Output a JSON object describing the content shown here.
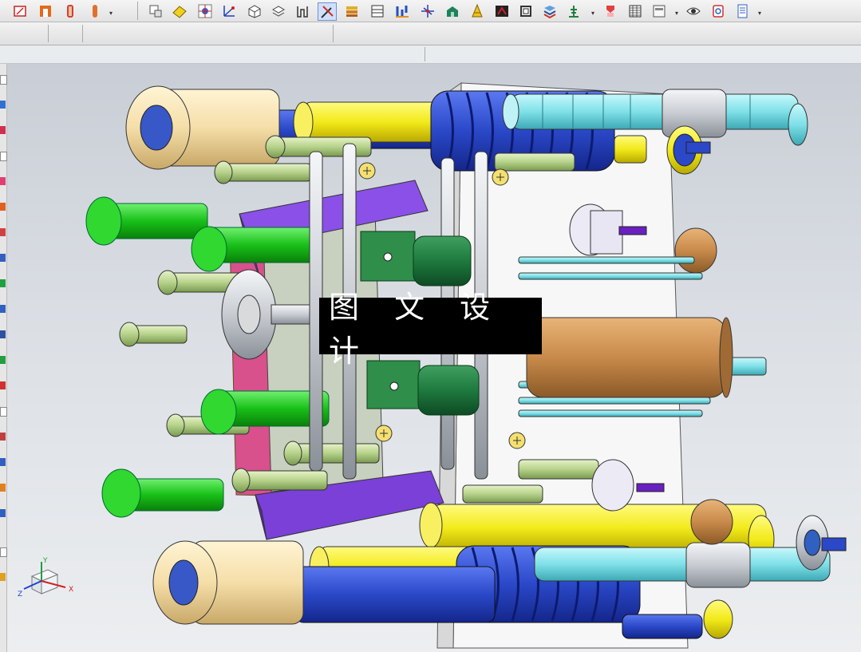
{
  "watermark": {
    "text": "图 文 设 计"
  },
  "triad": {
    "z_label": "Z",
    "x_label": "X",
    "y_label": "Y"
  },
  "toolbar_row1": {
    "icons": [
      "sketch-icon",
      "solid-icon",
      "extrude-icon",
      "revolve-icon",
      "view-icon",
      "table-icon",
      "wcs-icon",
      "cube-icon",
      "box-icon",
      "bracket-icon",
      "tools-icon",
      "stack-icon",
      "window-icon",
      "chart-icon",
      "balance-icon",
      "house-icon",
      "tower-icon",
      "film-icon",
      "grid-icon",
      "gear-icon",
      "puzzle-icon",
      "drill-icon",
      "table-grid-icon",
      "panel-icon",
      "eye-icon",
      "refresh-icon",
      "document-icon"
    ]
  },
  "toolbar_row2": {
    "icons": [
      "arrow-icon",
      "path-icon",
      "rope-icon",
      "select-box-icon",
      "eraser-icon",
      "cube-view-icon",
      "node-icon",
      "snap-icon",
      "line-icon",
      "curve-icon",
      "arc-icon",
      "circle-center-icon",
      "target-icon",
      "plus-icon",
      "slash-icon",
      "pin-icon",
      "grid-small-icon"
    ]
  },
  "colors": {
    "viewport_top": "#c9ced6",
    "viewport_bottom": "#eceef0",
    "yellow": "#f2ea1a",
    "blue": "#2a48c8",
    "green": "#18c018",
    "purple": "#7a40d8",
    "pink": "#d8508c",
    "cyan": "#7fe0e8",
    "orange": "#c88a4a",
    "tan": "#f5dea8"
  }
}
